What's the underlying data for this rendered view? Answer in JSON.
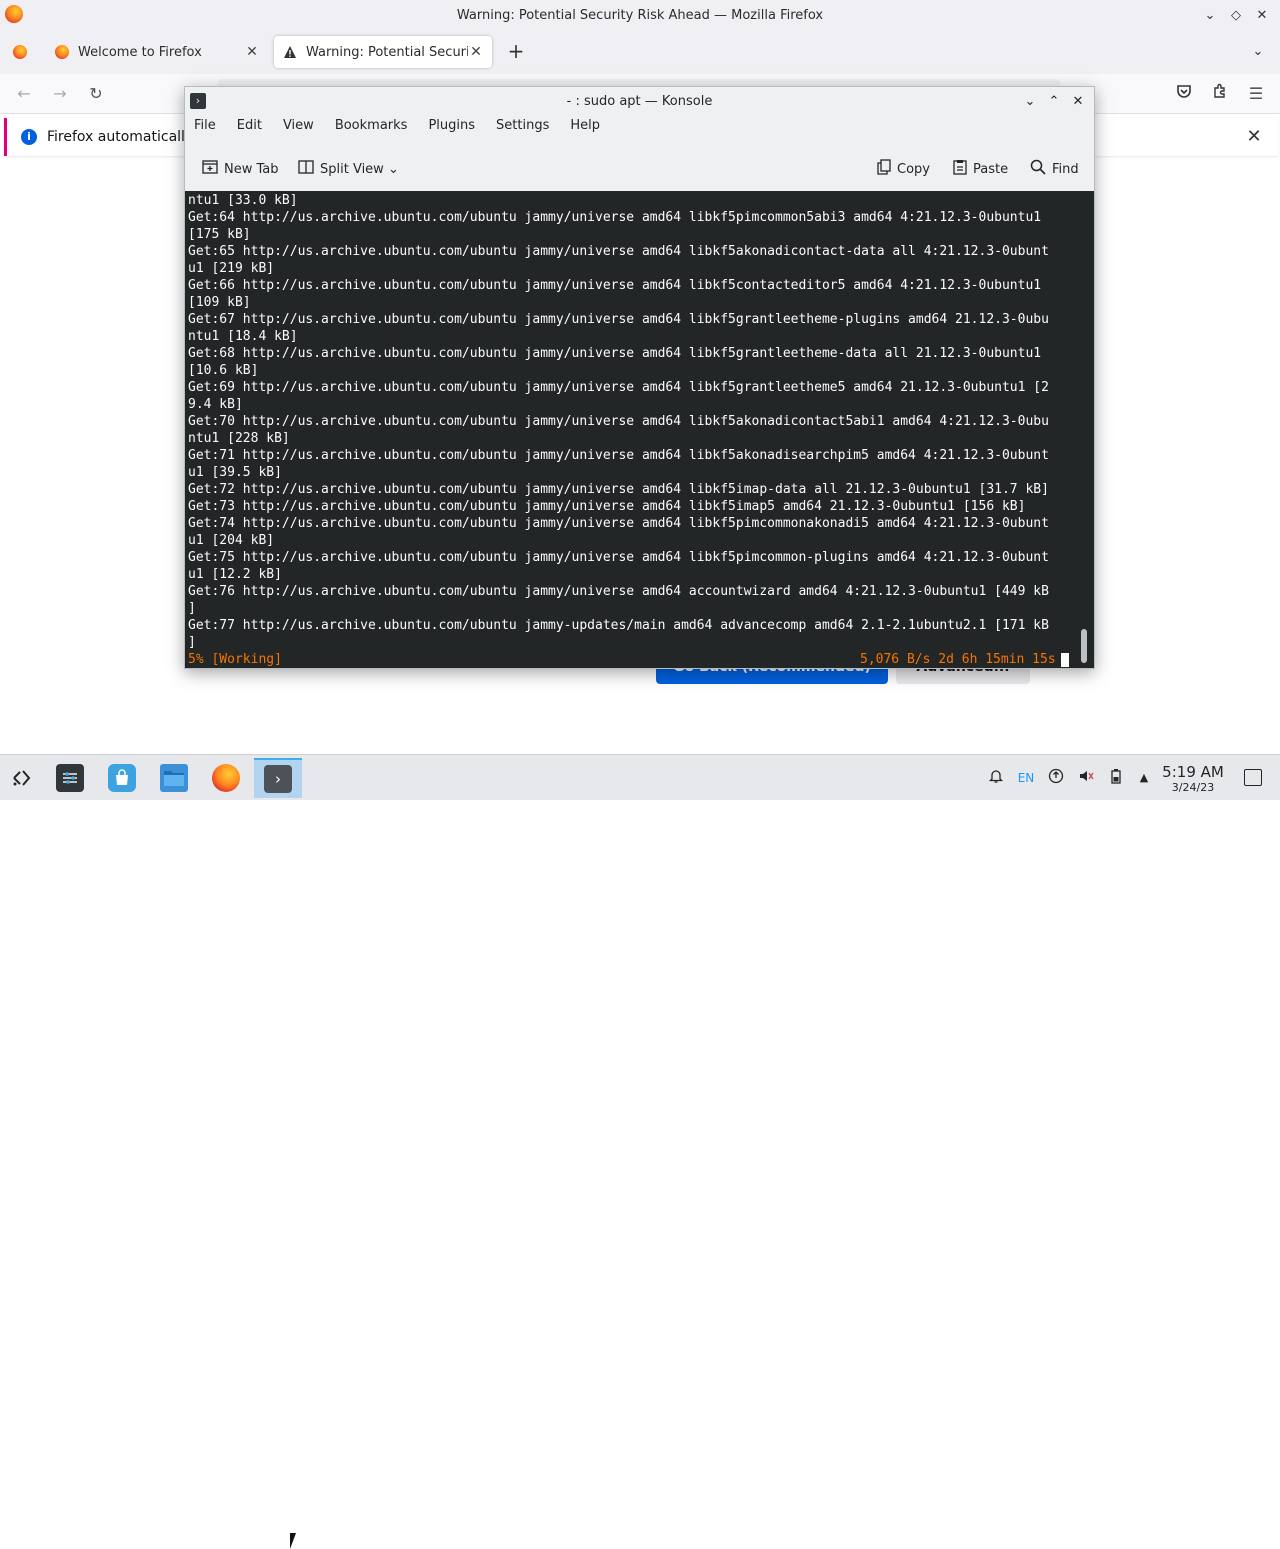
{
  "firefox": {
    "window_title": "Warning: Potential Security Risk Ahead — Mozilla Firefox",
    "tabs": [
      {
        "label": "Welcome to Firefox",
        "active": false
      },
      {
        "label": "Warning: Potential Security Risk Ahead",
        "active": true
      }
    ],
    "notification_text": "Firefox automatically s",
    "page_buttons": {
      "go_back": "Go Back (Recommended)",
      "advanced": "Advanced..."
    }
  },
  "konsole": {
    "title": "- : sudo apt — Konsole",
    "menu": [
      "File",
      "Edit",
      "View",
      "Bookmarks",
      "Plugins",
      "Settings",
      "Help"
    ],
    "toolbar": {
      "new_tab": "New Tab",
      "split_view": "Split View",
      "copy": "Copy",
      "paste": "Paste",
      "find": "Find"
    },
    "terminal_lines": [
      "ntu1 [33.0 kB]",
      "Get:64 http://us.archive.ubuntu.com/ubuntu jammy/universe amd64 libkf5pimcommon5abi3 amd64 4:21.12.3-0ubuntu1",
      "[175 kB]",
      "Get:65 http://us.archive.ubuntu.com/ubuntu jammy/universe amd64 libkf5akonadicontact-data all 4:21.12.3-0ubunt",
      "u1 [219 kB]",
      "Get:66 http://us.archive.ubuntu.com/ubuntu jammy/universe amd64 libkf5contacteditor5 amd64 4:21.12.3-0ubuntu1",
      "[109 kB]",
      "Get:67 http://us.archive.ubuntu.com/ubuntu jammy/universe amd64 libkf5grantleetheme-plugins amd64 21.12.3-0ubu",
      "ntu1 [18.4 kB]",
      "Get:68 http://us.archive.ubuntu.com/ubuntu jammy/universe amd64 libkf5grantleetheme-data all 21.12.3-0ubuntu1",
      "[10.6 kB]",
      "Get:69 http://us.archive.ubuntu.com/ubuntu jammy/universe amd64 libkf5grantleetheme5 amd64 21.12.3-0ubuntu1 [2",
      "9.4 kB]",
      "Get:70 http://us.archive.ubuntu.com/ubuntu jammy/universe amd64 libkf5akonadicontact5abi1 amd64 4:21.12.3-0ubu",
      "ntu1 [228 kB]",
      "Get:71 http://us.archive.ubuntu.com/ubuntu jammy/universe amd64 libkf5akonadisearchpim5 amd64 4:21.12.3-0ubunt",
      "u1 [39.5 kB]",
      "Get:72 http://us.archive.ubuntu.com/ubuntu jammy/universe amd64 libkf5imap-data all 21.12.3-0ubuntu1 [31.7 kB]",
      "Get:73 http://us.archive.ubuntu.com/ubuntu jammy/universe amd64 libkf5imap5 amd64 21.12.3-0ubuntu1 [156 kB]",
      "Get:74 http://us.archive.ubuntu.com/ubuntu jammy/universe amd64 libkf5pimcommonakonadi5 amd64 4:21.12.3-0ubunt",
      "u1 [204 kB]",
      "Get:75 http://us.archive.ubuntu.com/ubuntu jammy/universe amd64 libkf5pimcommon-plugins amd64 4:21.12.3-0ubunt",
      "u1 [12.2 kB]",
      "Get:76 http://us.archive.ubuntu.com/ubuntu jammy/universe amd64 accountwizard amd64 4:21.12.3-0ubuntu1 [449 kB",
      "]",
      "Get:77 http://us.archive.ubuntu.com/ubuntu jammy-updates/main amd64 advancecomp amd64 2.1-2.1ubuntu2.1 [171 kB",
      "]"
    ],
    "status_left": "5% [Working]",
    "status_right": "5,076 B/s 2d 6h 15min 15s"
  },
  "taskbar": {
    "lang": "EN",
    "time": "5:19 AM",
    "date": "3/24/23",
    "icons": [
      "application-launcher-icon",
      "system-settings-icon",
      "discover-store-icon",
      "file-manager-icon",
      "firefox-icon",
      "konsole-icon"
    ]
  },
  "colors": {
    "terminal_bg": "#232627",
    "terminal_fg": "#fcfcfc",
    "status_orange": "#f67400",
    "firefox_button_blue": "#0061e0",
    "taskbar_active": "#3daee9"
  }
}
